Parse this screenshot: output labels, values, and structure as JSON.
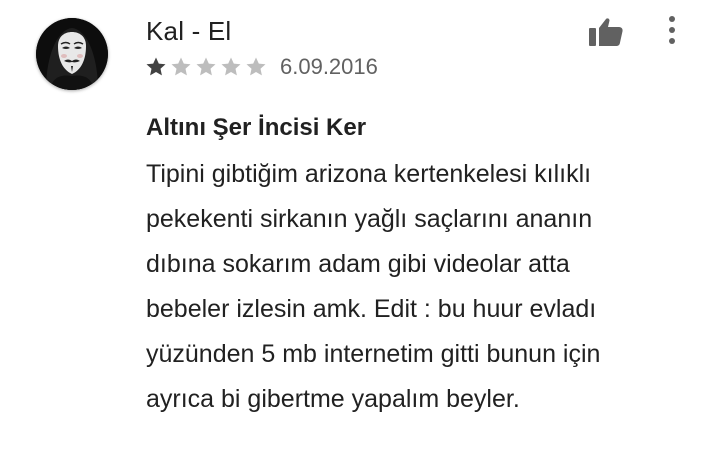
{
  "review": {
    "author": "Kal - El",
    "rating": 1,
    "max_rating": 5,
    "date": "6.09.2016",
    "title": "Altını Şer İncisi Ker",
    "body_lines": [
      "Tipini gibtiğim arizona kertenkelesi kılıklı",
      "pekekenti sirkanın yağlı saçlarını ananın",
      "dıbına sokarım adam gibi videolar atta",
      "bebeler izlesin amk. Edit : bu huur evladı",
      "yüzünden 5 mb internetim gitti bunun için",
      "ayrıca bi gibertme yapalım beyler."
    ]
  },
  "icons": {
    "avatar": "masked-face-avatar",
    "helpful": "thumbs-up-icon",
    "more": "more-vert-icon",
    "star_filled": "star-filled-icon",
    "star_empty": "star-empty-icon"
  },
  "colors": {
    "text_primary": "#212121",
    "text_secondary": "#616161",
    "star_filled": "#424242",
    "star_empty": "#bdbdbd",
    "icon": "#616161"
  }
}
